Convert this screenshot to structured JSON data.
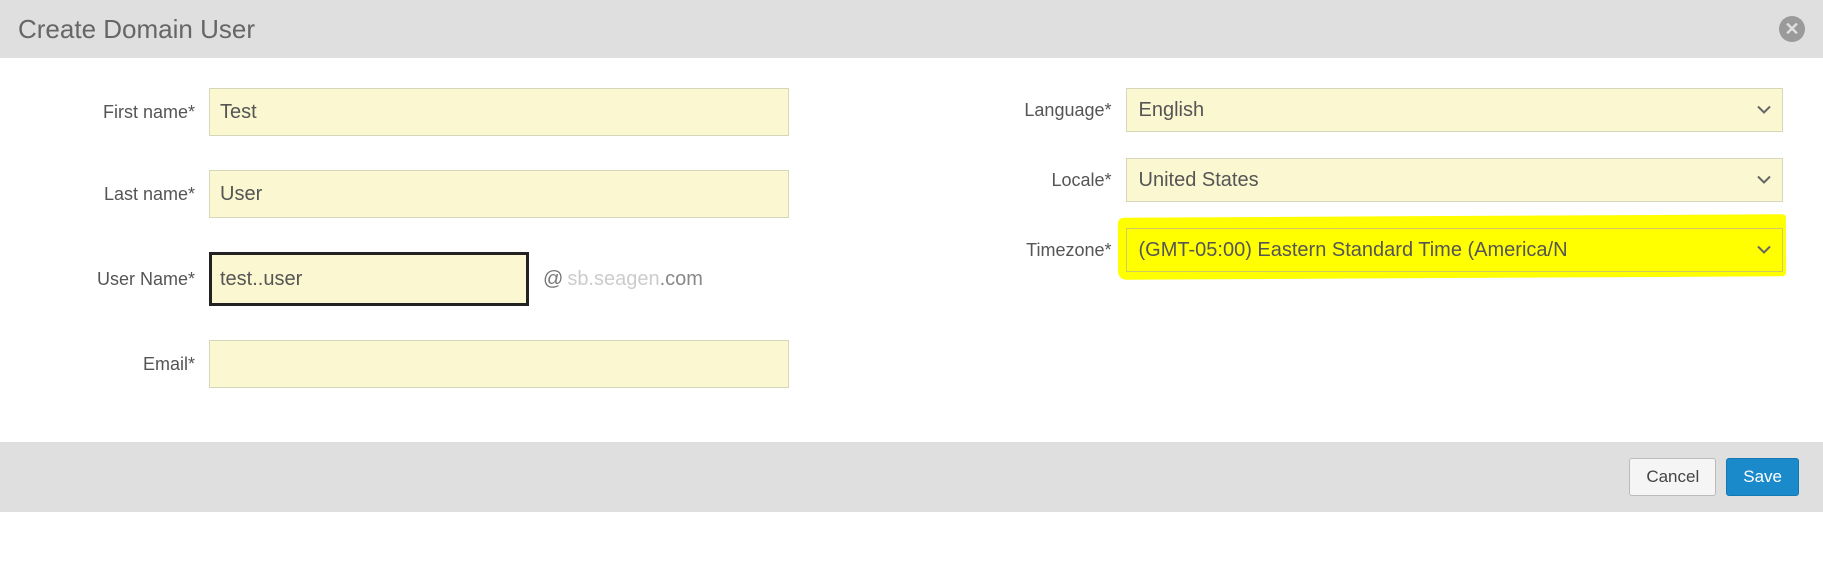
{
  "header": {
    "title": "Create Domain User"
  },
  "form": {
    "left": {
      "first_name": {
        "label": "First name*",
        "value": "Test"
      },
      "last_name": {
        "label": "Last name*",
        "value": "User"
      },
      "user_name": {
        "label": "User Name*",
        "value": "test..user",
        "domain_at": "@",
        "domain_faded": "sb.seagen",
        "domain_tail": ".com"
      },
      "email": {
        "label": "Email*",
        "value": ""
      }
    },
    "right": {
      "language": {
        "label": "Language*",
        "value": "English"
      },
      "locale": {
        "label": "Locale*",
        "value": "United States"
      },
      "timezone": {
        "label": "Timezone*",
        "value": "(GMT-05:00) Eastern Standard Time (America/N"
      }
    }
  },
  "footer": {
    "cancel": "Cancel",
    "save": "Save"
  }
}
